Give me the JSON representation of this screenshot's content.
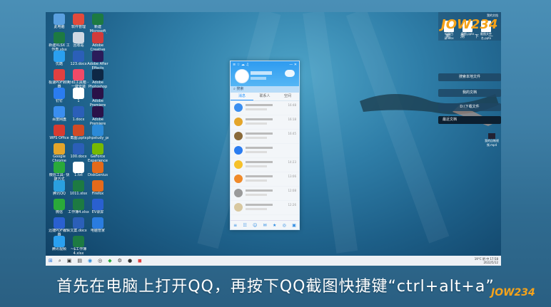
{
  "desktop_icons": [
    {
      "label": "此电脑",
      "color": "#5aa0e0"
    },
    {
      "label": "软件管理",
      "color": "#e24a3b"
    },
    {
      "label": "新建Microsoft Excel 工作表",
      "color": "#1d7a42"
    },
    {
      "label": "新建XLSX 工作表.xlsx",
      "color": "#1d7a42"
    },
    {
      "label": "回收站",
      "color": "#cfd8e3"
    },
    {
      "label": "Adobe Creative Cloud",
      "color": "#d23b3b"
    },
    {
      "label": "优酷",
      "color": "#2aa0f0"
    },
    {
      "label": "123.docx",
      "color": "#2b5fb8"
    },
    {
      "label": "Adobe After Effects 2020",
      "color": "#2b1c5a"
    },
    {
      "label": "极速PDF转换器",
      "color": "#e04040"
    },
    {
      "label": "小红工具箱 -一键安装",
      "color": "#f04a68"
    },
    {
      "label": "Adobe Photoshop 2020",
      "color": "#0e2845"
    },
    {
      "label": "钉钉",
      "color": "#2a7cf0"
    },
    {
      "label": "1",
      "color": "#ffffff"
    },
    {
      "label": "Adobe Premiere Pro 2020",
      "color": "#2a1248"
    },
    {
      "label": "百度网盘",
      "color": "#3a8ef0"
    },
    {
      "label": "1.docx",
      "color": "#2b5fb8"
    },
    {
      "label": "Adobe Premiere Pro 2022",
      "color": "#2a1248"
    },
    {
      "label": "WPS Office",
      "color": "#d83a2f"
    },
    {
      "label": "截图.pptx",
      "color": "#d04a25"
    },
    {
      "label": "phpstudy_pro",
      "color": "#2b8ad8"
    },
    {
      "label": "Google Chrome",
      "color": "#e4a52a"
    },
    {
      "label": "100.docx",
      "color": "#2b5fb8"
    },
    {
      "label": "GeForce Experience",
      "color": "#76b900"
    },
    {
      "label": "微信工具- 快捷方式",
      "color": "#2aaa3a"
    },
    {
      "label": "1.txt",
      "color": "#ffffff"
    },
    {
      "label": "DiskGenius",
      "color": "#e46a1a"
    },
    {
      "label": "腾讯QQ",
      "color": "#2aa0e0"
    },
    {
      "label": "1011.xlsx",
      "color": "#1d7a42"
    },
    {
      "label": "Firefox",
      "color": "#e46a1a"
    },
    {
      "label": "微信",
      "color": "#2aaa3a"
    },
    {
      "label": "工作簿4.xlsx",
      "color": "#1d7a42"
    },
    {
      "label": "EV录屏",
      "color": "#2a60d0"
    },
    {
      "label": "迅捷PDF编辑器",
      "color": "#2a60d0"
    },
    {
      "label": "文案.docx",
      "color": "#2b5fb8"
    },
    {
      "label": "电脑管家",
      "color": "#2a7ce0"
    },
    {
      "label": "腾讯视频",
      "color": "#2aa0f0"
    },
    {
      "label": "~$工作簿4.xlsx",
      "color": "#1d7a42"
    }
  ],
  "qq": {
    "search_placeholder": "搜索",
    "tabs": [
      "消息",
      "联系人",
      "空间"
    ],
    "rows": [
      {
        "avatar": "#3a8ef0",
        "time": "16:48"
      },
      {
        "avatar": "#e4a52a",
        "time": "16:18"
      },
      {
        "avatar": "#8a6a3a",
        "time": "16:45"
      },
      {
        "avatar": "#2a7cf0",
        "time": ""
      },
      {
        "avatar": "#f6c12a",
        "time": "14:23"
      },
      {
        "avatar": "#f08a2a",
        "time": "13:06"
      },
      {
        "avatar": "#9a9a9a",
        "time": "12:08"
      },
      {
        "avatar": "#d8c8a0",
        "time": "12:26"
      }
    ],
    "bottom_icons": [
      "≡",
      "☷",
      "☺",
      "✉",
      "★",
      "◎",
      "▣"
    ]
  },
  "right_panel": {
    "top_label": "我的文档",
    "files": [
      "轻量目录.xlsx",
      "截图.pptx",
      "截图文件名.pptx"
    ],
    "btn_search": "搜索本地文件",
    "btn_mydocs": "我的文档",
    "btn_diskdocs": "D:\\下载文件",
    "btn_recent": "最近文档",
    "desktop_file": "我的自制视频.mp4"
  },
  "taskbar": {
    "weather": "19°C 阴",
    "lang": "中",
    "time": "17:58",
    "date": "2022/5/12"
  },
  "caption": "首先在电脑上打开QQ，再按下QQ截图快捷键“ctrl+alt+a”",
  "logo": {
    "text": "JOW234",
    "sub": "前 溯 下 一 ",
    "bottom": "JOW234"
  }
}
